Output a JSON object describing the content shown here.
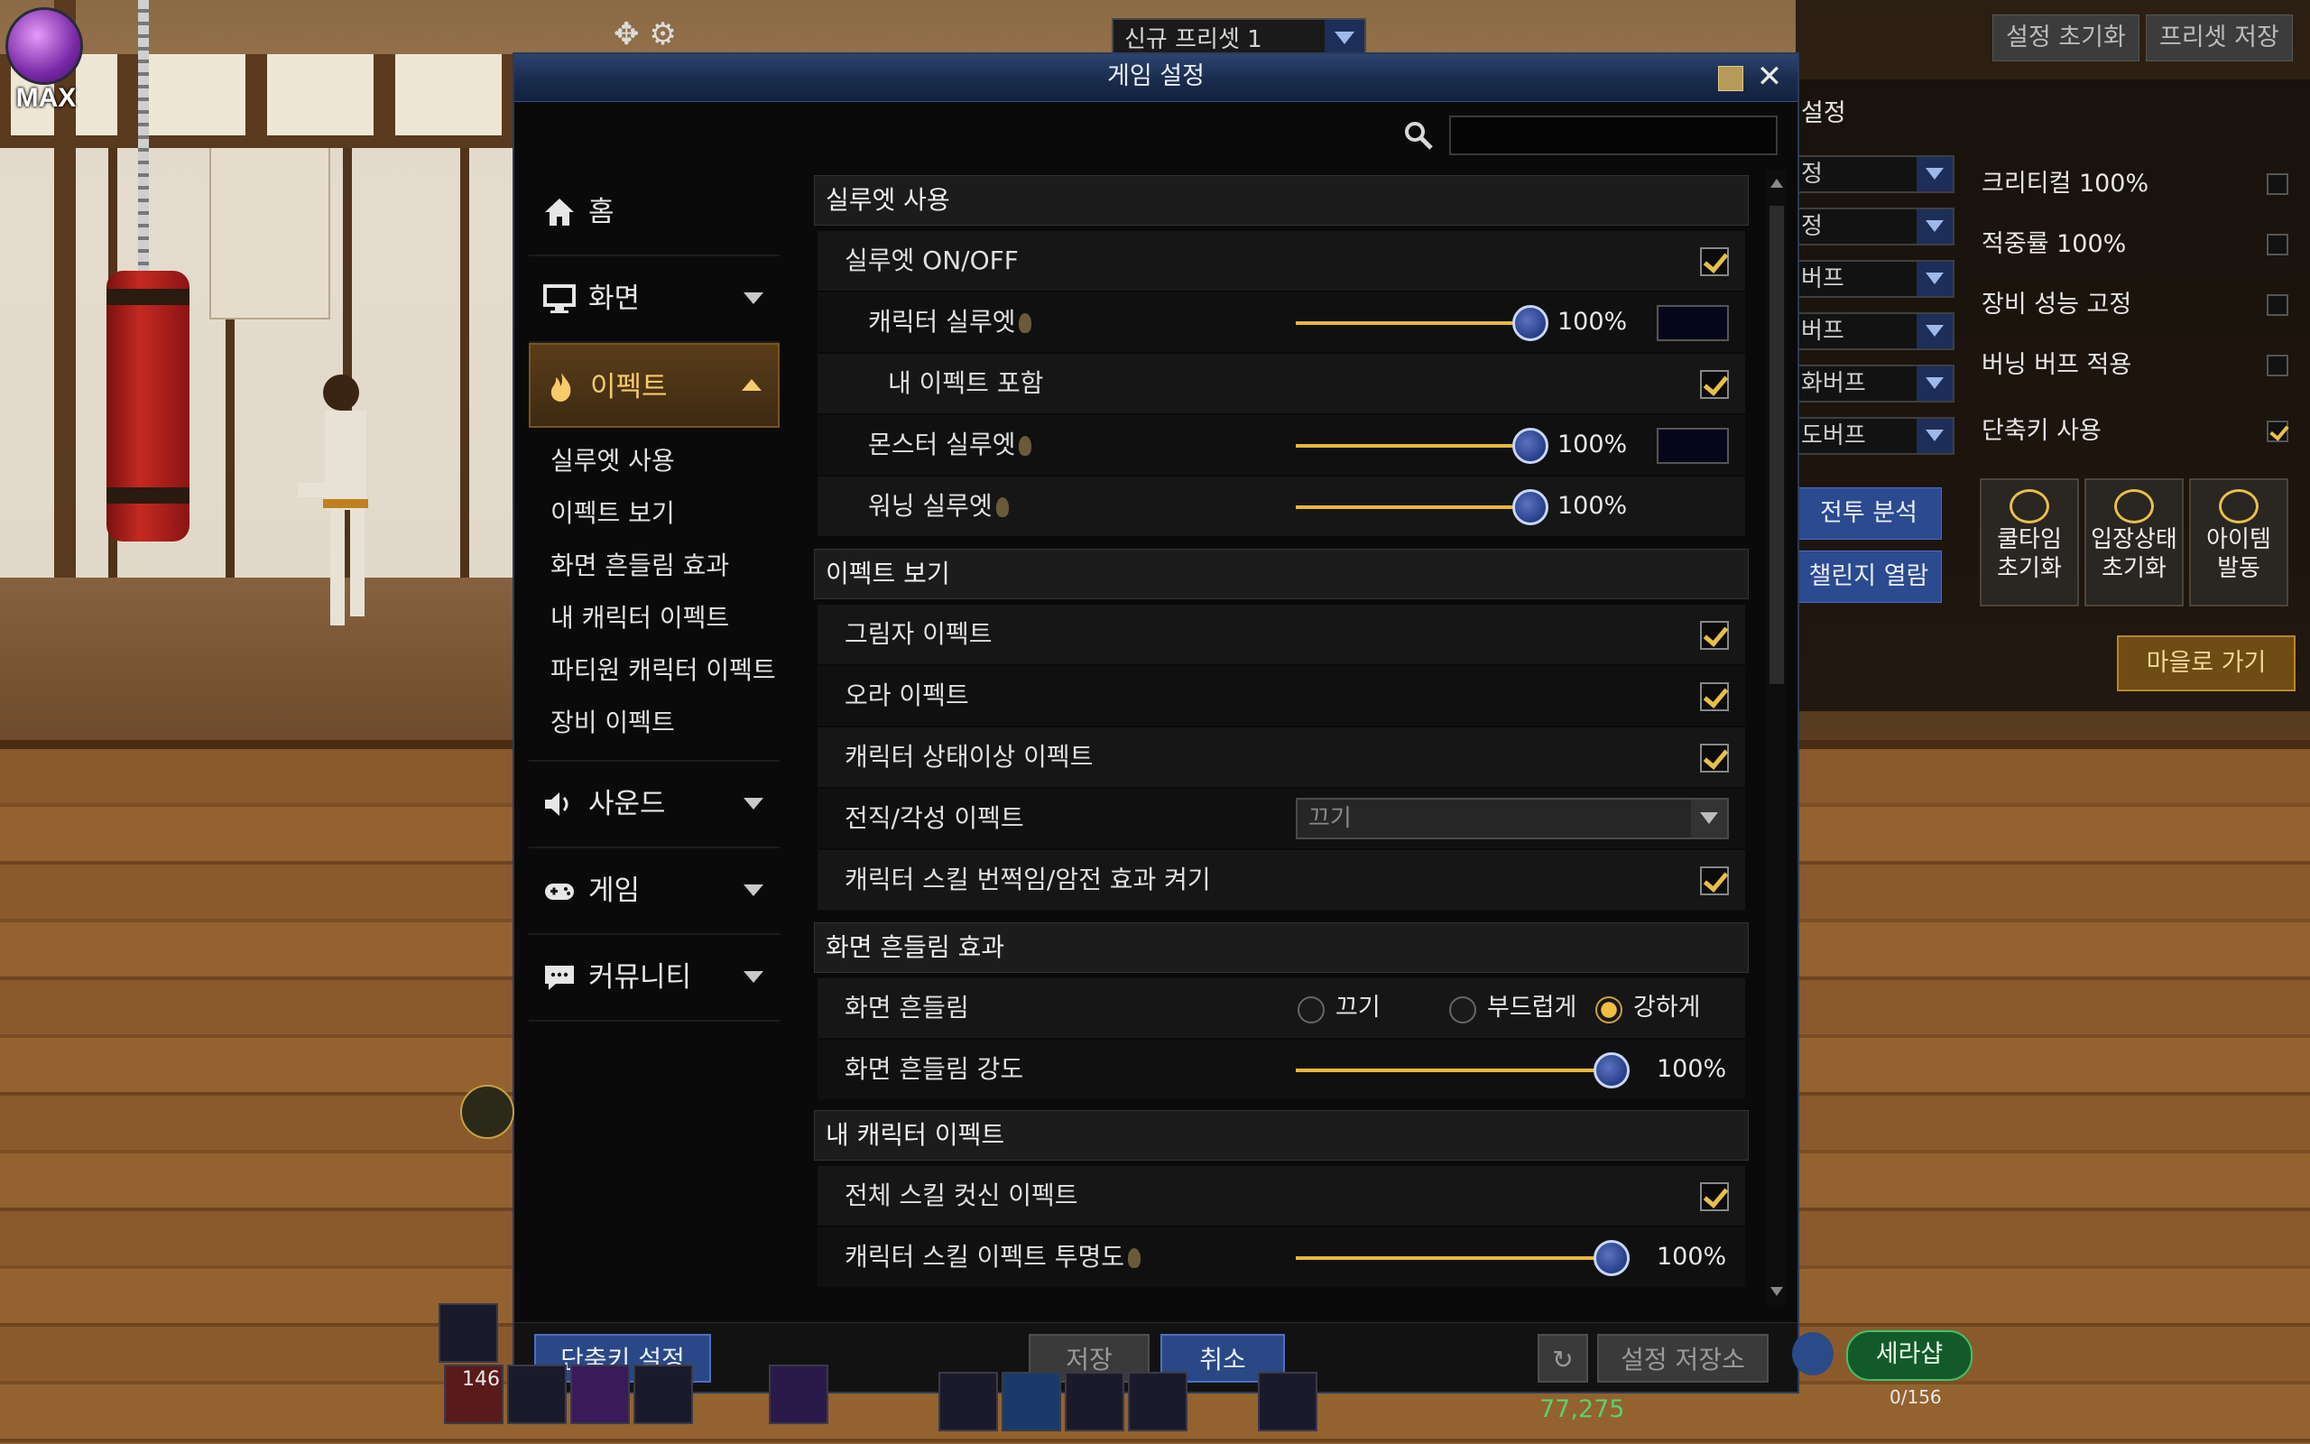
{
  "badge": {
    "text": "MAX"
  },
  "top": {
    "preset_select": "신규 프리셋 1",
    "reset_button": "설정 초기화",
    "save_preset_button": "프리셋 저장"
  },
  "right_panel": {
    "title": "설정",
    "dropdowns": [
      "정",
      "정",
      "버프",
      "버프",
      "화버프",
      "도버프"
    ],
    "checks": [
      {
        "label": "크리티컬 100%",
        "checked": false
      },
      {
        "label": "적중률 100%",
        "checked": false
      },
      {
        "label": "장비 성능 고정",
        "checked": false
      },
      {
        "label": "버닝 버프 적용",
        "checked": false
      },
      {
        "label": "단축키 사용",
        "checked": true
      }
    ],
    "battle_analysis": "전투 분석",
    "challenge_view": "챌린지 열람",
    "tiles": [
      {
        "line1": "쿨타임",
        "line2": "초기화"
      },
      {
        "line1": "입장상태",
        "line2": "초기화"
      },
      {
        "line1": "아이템",
        "line2": "발동"
      }
    ],
    "to_town": "마을로 가기"
  },
  "dialog": {
    "title": "게임 설정",
    "search_placeholder": "",
    "sidebar": {
      "home": "홈",
      "screen": "화면",
      "effect": "이펙트",
      "effect_subs": [
        "실루엣 사용",
        "이펙트 보기",
        "화면 흔들림 효과",
        "내 캐릭터 이펙트",
        "파티원 캐릭터 이펙트",
        "장비 이펙트"
      ],
      "sound": "사운드",
      "game": "게임",
      "community": "커뮤니티"
    },
    "sections": {
      "silhouette": {
        "header": "실루엣 사용",
        "onoff": "실루엣 ON/OFF",
        "char": "캐릭터 실루엣",
        "char_value": "100%",
        "my_effect": "내 이펙트 포함",
        "monster": "몬스터 실루엣",
        "monster_value": "100%",
        "warning": "워닝 실루엣",
        "warning_value": "100%"
      },
      "effect_view": {
        "header": "이펙트 보기",
        "shadow": "그림자 이펙트",
        "aura": "오라 이펙트",
        "status": "캐릭터 상태이상 이펙트",
        "awakening": "전직/각성 이펙트",
        "awakening_value": "끄기",
        "flash": "캐릭터 스킬 번쩍임/암전 효과 켜기"
      },
      "shake": {
        "header": "화면 흔들림 효과",
        "shake": "화면 흔들림",
        "opt_off": "끄기",
        "opt_soft": "부드럽게",
        "opt_strong": "강하게",
        "intensity": "화면 흔들림 강도",
        "intensity_value": "100%"
      },
      "my_char": {
        "header": "내 캐릭터 이펙트",
        "cutin": "전체 스킬 컷신 이펙트",
        "opacity": "캐릭터 스킬 이펙트 투명도",
        "opacity_value": "100%"
      }
    },
    "levels": {
      "char_silhouette": 1.0,
      "monster_silhouette": 1.0,
      "warning_silhouette": 1.0,
      "shake_intensity": 1.0,
      "skill_opacity": 1.0
    },
    "footer": {
      "hotkey": "단축키 설정",
      "save": "저장",
      "cancel": "취소",
      "storage": "설정 저장소"
    }
  },
  "hud": {
    "level_num": "146",
    "gold": "77,275",
    "xp": "0/156",
    "cera": "세라샵"
  },
  "colors": {
    "accent_gold": "#e6bf49",
    "blue_button": "#2a4886",
    "title_bar": "#1a2c4e"
  }
}
